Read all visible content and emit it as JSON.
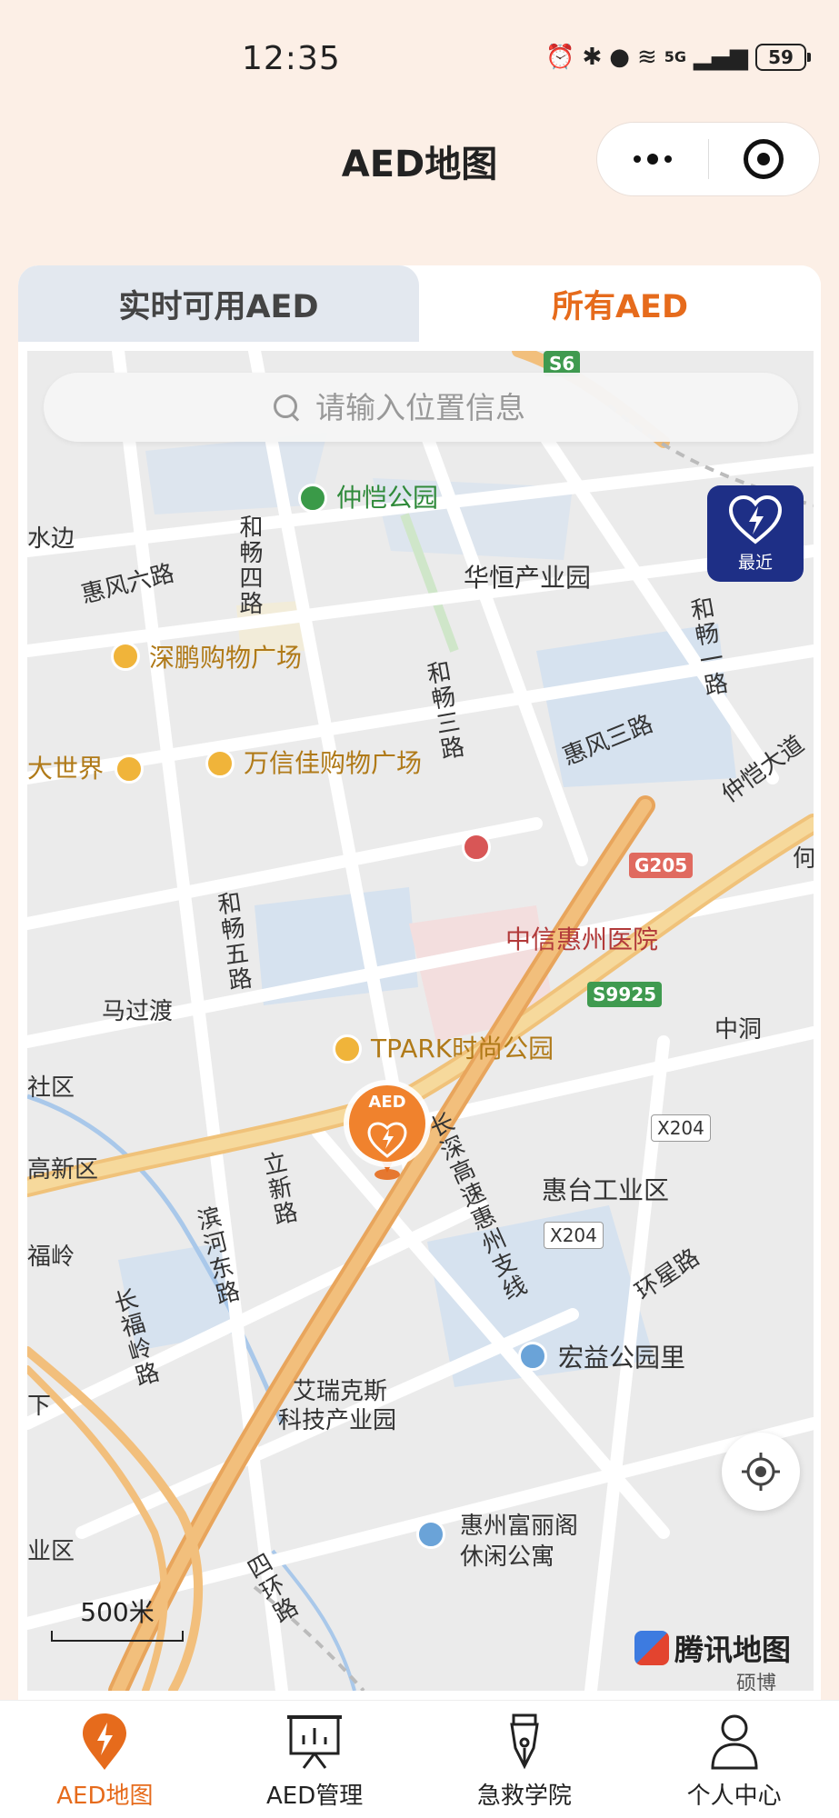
{
  "status_bar": {
    "time": "12:35",
    "network": "5G",
    "battery": "59"
  },
  "header": {
    "title": "AED地图"
  },
  "tabs": [
    {
      "label": "实时可用AED",
      "active": false
    },
    {
      "label": "所有AED",
      "active": true
    }
  ],
  "search": {
    "placeholder": "请输入位置信息"
  },
  "map": {
    "nearest_button_label": "最近",
    "aed_marker_label": "AED",
    "scale_label": "500米",
    "provider_logo": "腾讯地图",
    "labels": {
      "zhongkai_park": "仲恺公园",
      "shuibian": "水边",
      "huifeng_6": "惠风六路",
      "hechang_4": "和畅四路",
      "huaheng_park": "华恒产业园",
      "hechang_1": "和畅一路",
      "shenpeng_mall": "深鹏购物广场",
      "hechang_3": "和畅三路",
      "huifeng_3": "惠风三路",
      "zhongkai_ave": "仲恺大道",
      "dashijie": "大世界",
      "wanxinjia_mall": "万信佳购物广场",
      "he": "何",
      "hechang_5": "和畅五路",
      "citic_hospital": "中信惠州医院",
      "maguodu": "马过渡",
      "zhongdong": "中洞",
      "tpark": "TPARK时尚公园",
      "shequ": "社区",
      "gaoxinqu": "高新区",
      "changshen": "长深高速惠州支线",
      "lixin_road": "立新路",
      "huitai_industrial": "惠台工业区",
      "fuling": "福岭",
      "binhe_east": "滨河东路",
      "huanxing_road": "环星路",
      "changfuling": "长福岭路",
      "hongyi_park": "宏益公园里",
      "xia": "下",
      "airuikesi_1": "艾瑞克斯",
      "airuikesi_2": "科技产业园",
      "yequ": "业区",
      "sihuan_road": "四环路",
      "fuli_1": "惠州富丽阁",
      "fuli_2": "休闲公寓",
      "bottom_cut": "硕博"
    },
    "shields": {
      "s6": "S6",
      "g205": "G205",
      "s9925": "S9925",
      "x204_a": "X204",
      "x204_b": "X204"
    }
  },
  "bottom_nav": [
    {
      "label": "AED地图",
      "icon": "aed-map-icon",
      "active": true
    },
    {
      "label": "AED管理",
      "icon": "presentation-board-icon",
      "active": false
    },
    {
      "label": "急救学院",
      "icon": "pen-nib-icon",
      "active": false
    },
    {
      "label": "个人中心",
      "icon": "person-icon",
      "active": false
    }
  ],
  "colors": {
    "accent": "#e66b1c",
    "nearest_button": "#1e2f86",
    "page_background": "#fcefe6"
  }
}
